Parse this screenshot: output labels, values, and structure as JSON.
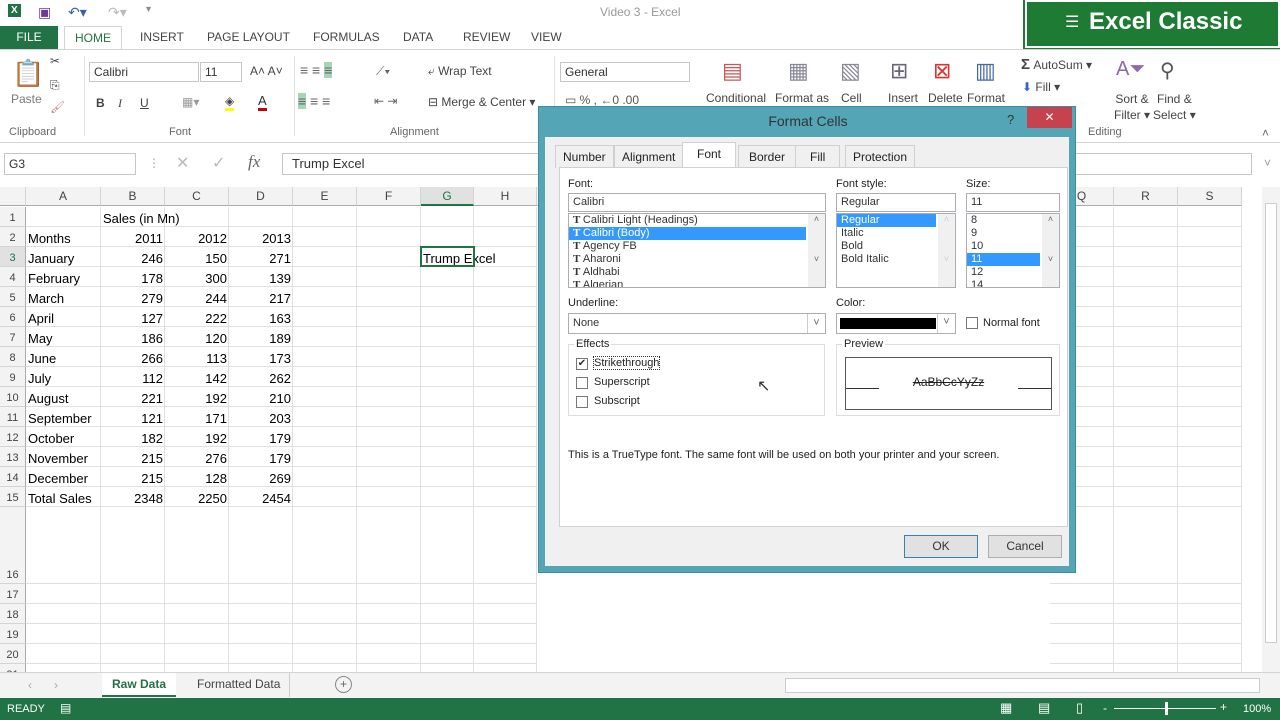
{
  "window": {
    "title": "Video 3 - Excel",
    "brand": "Excel Classic"
  },
  "ribbon_tabs": [
    "FILE",
    "HOME",
    "INSERT",
    "PAGE LAYOUT",
    "FORMULAS",
    "DATA",
    "REVIEW",
    "VIEW"
  ],
  "ribbon": {
    "paste": "Paste",
    "font_name": "Calibri",
    "font_size": "11",
    "wrap_text": "Wrap Text",
    "merge_center": "Merge & Center",
    "number_format": "General",
    "conditional": "Conditional",
    "format_as": "Format as",
    "cell": "Cell",
    "insert": "Insert",
    "delete": "Delete",
    "format": "Format",
    "autosum": "AutoSum",
    "fill": "Fill",
    "sort_filter_1": "Sort &",
    "sort_filter_2": "Filter",
    "find_select_1": "Find &",
    "find_select_2": "Select",
    "groups": {
      "clipboard": "Clipboard",
      "font": "Font",
      "alignment": "Alignment",
      "editing": "Editing"
    },
    "bold": "B",
    "italic": "I",
    "underline": "U"
  },
  "formula_bar": {
    "name_box": "G3",
    "formula": "Trump Excel",
    "fx": "fx"
  },
  "columns": [
    "A",
    "B",
    "C",
    "D",
    "E",
    "F",
    "G",
    "H"
  ],
  "right_columns": [
    "Q",
    "R",
    "S"
  ],
  "row_numbers": [
    "1",
    "2",
    "3",
    "4",
    "5",
    "6",
    "7",
    "8",
    "9",
    "10",
    "11",
    "12",
    "13",
    "14",
    "15",
    "16",
    "17",
    "18",
    "19",
    "20",
    "21"
  ],
  "cells": {
    "B1": "Sales (in Mn)",
    "rows": [
      [
        "Months",
        "2011",
        "2012",
        "2013"
      ],
      [
        "January",
        "246",
        "150",
        "271"
      ],
      [
        "February",
        "178",
        "300",
        "139"
      ],
      [
        "March",
        "279",
        "244",
        "217"
      ],
      [
        "April",
        "127",
        "222",
        "163"
      ],
      [
        "May",
        "186",
        "120",
        "189"
      ],
      [
        "June",
        "266",
        "113",
        "173"
      ],
      [
        "July",
        "112",
        "142",
        "262"
      ],
      [
        "August",
        "221",
        "192",
        "210"
      ],
      [
        "September",
        "121",
        "171",
        "203"
      ],
      [
        "October",
        "182",
        "192",
        "179"
      ],
      [
        "November",
        "215",
        "276",
        "179"
      ],
      [
        "December",
        "215",
        "128",
        "269"
      ],
      [
        "Total Sales",
        "2348",
        "2250",
        "2454"
      ]
    ],
    "G3": "Trump Excel"
  },
  "sheets": {
    "tabs": [
      "Raw Data",
      "Formatted Data"
    ],
    "active": "Raw Data"
  },
  "status": {
    "text": "READY",
    "zoom": "100%"
  },
  "dialog": {
    "title": "Format Cells",
    "help": "?",
    "tabs": [
      "Number",
      "Alignment",
      "Font",
      "Border",
      "Fill",
      "Protection"
    ],
    "active_tab": "Font",
    "font_label": "Font:",
    "font_value": "Calibri",
    "fonts": [
      "Calibri Light (Headings)",
      "Calibri (Body)",
      "Agency FB",
      "Aharoni",
      "Aldhabi",
      "Algerian"
    ],
    "font_selected": "Calibri (Body)",
    "style_label": "Font style:",
    "style_value": "Regular",
    "styles": [
      "Regular",
      "Italic",
      "Bold",
      "Bold Italic"
    ],
    "size_label": "Size:",
    "size_value": "11",
    "sizes": [
      "8",
      "9",
      "10",
      "11",
      "12",
      "14"
    ],
    "underline_label": "Underline:",
    "underline_value": "None",
    "color_label": "Color:",
    "color_value": "#000000",
    "normal_font": "Normal font",
    "normal_font_checked": false,
    "effects_label": "Effects",
    "effects": [
      {
        "label": "Strikethrough",
        "checked": true
      },
      {
        "label": "Superscript",
        "checked": false
      },
      {
        "label": "Subscript",
        "checked": false
      }
    ],
    "preview_label": "Preview",
    "preview_text": "AaBbCcYyZz",
    "info": "This is a TrueType font.  The same font will be used on both your printer and your screen.",
    "ok": "OK",
    "cancel": "Cancel"
  },
  "colors": {
    "excel_green": "#217346",
    "dialog_frame": "#54a6b6",
    "selection": "#3399ff",
    "close": "#c7424f"
  }
}
